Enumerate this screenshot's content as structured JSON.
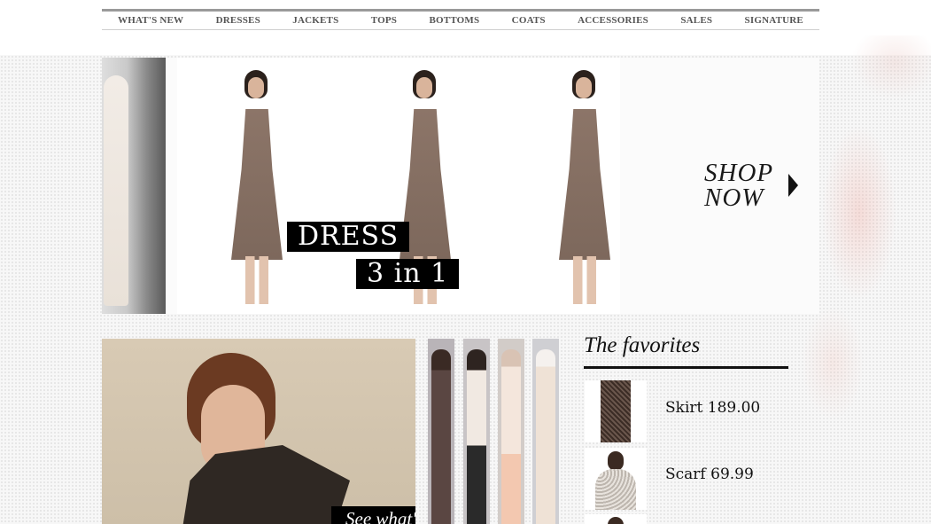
{
  "nav": {
    "items": [
      "WHAT'S NEW",
      "DRESSES",
      "JACKETS",
      "TOPS",
      "BOTTOMS",
      "COATS",
      "ACCESSORIES",
      "SALES",
      "SIGNATURE"
    ]
  },
  "hero": {
    "label_line1": "DRESS",
    "label_line2": "3 in 1",
    "shop_line1": "SHOP",
    "shop_line2": "NOW"
  },
  "feature": {
    "cta": "See what's new !"
  },
  "favorites": {
    "title": "The favorites",
    "items": [
      {
        "name": "Skirt",
        "price": "189.00"
      },
      {
        "name": "Scarf",
        "price": "69.99"
      }
    ]
  },
  "colors": {
    "accent": "#000000",
    "nav_text": "#555555",
    "dress": "#8c7568"
  }
}
